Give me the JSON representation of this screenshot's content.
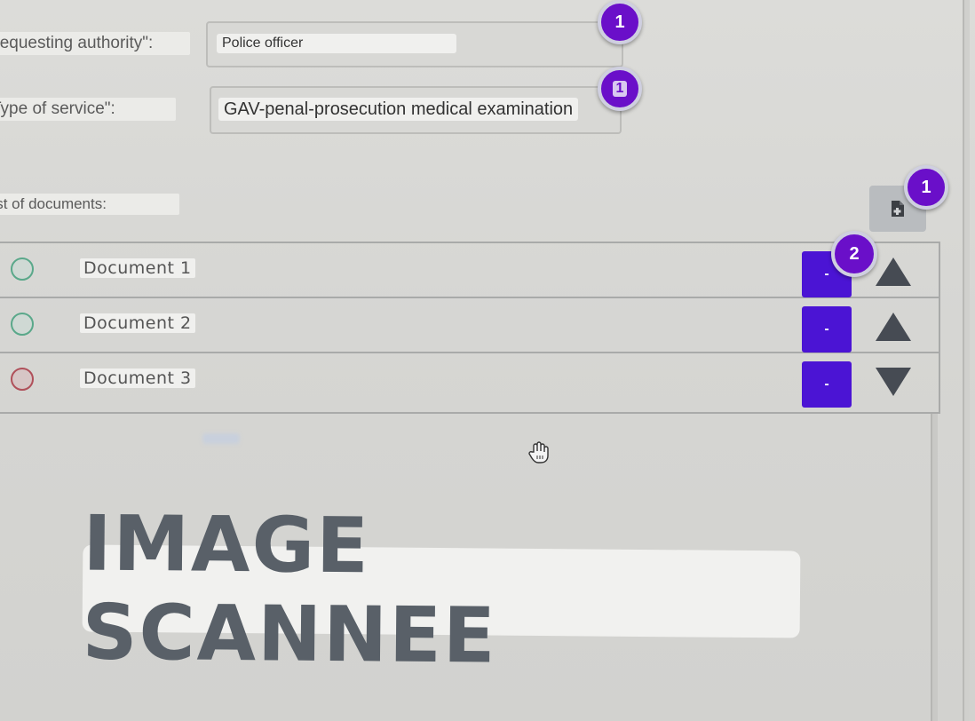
{
  "form": {
    "requesting_authority_label": "Requesting authority\":",
    "requesting_authority_value": "Police officer",
    "type_of_service_label": "Type of service\":",
    "type_of_service_value": "GAV-penal-prosecution medical examination",
    "list_of_documents_label": "List of documents:"
  },
  "badges": {
    "authority": "1",
    "service": "1",
    "add_document": "1",
    "document_row": "2"
  },
  "documents": [
    {
      "name": "Document 1",
      "status": "green",
      "remove_label": "-",
      "arrow": "up"
    },
    {
      "name": "Document 2",
      "status": "green",
      "remove_label": "-",
      "arrow": "up"
    },
    {
      "name": "Document 3",
      "status": "red",
      "remove_label": "-",
      "arrow": "down"
    }
  ],
  "stamp_text": "IMAGE SCANNEE",
  "icons": {
    "add_document": "file-plus-icon",
    "cursor": "hand-cursor-icon"
  },
  "colors": {
    "badge": "#6a0fc9",
    "remove_button": "#4b14d4",
    "status_green": "#5aa88a",
    "status_red": "#b0505a"
  }
}
